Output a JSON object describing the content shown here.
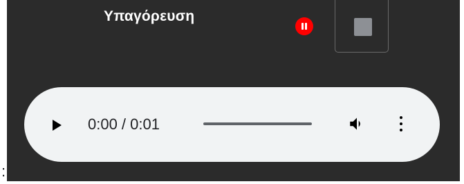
{
  "dictation": {
    "title": "Υπαγόρευση",
    "pause_icon": "pause-circle-icon",
    "stop_icon": "stop-square-icon",
    "colors": {
      "panel_bg": "#2b2b2b",
      "recording_red": "#ff0000",
      "stop_square": "#8d9095"
    }
  },
  "audio_player": {
    "time_display": "0:00 / 0:01",
    "progress_fraction": 0,
    "icons": {
      "play": "play-icon",
      "volume": "volume-icon",
      "more": "more-vertical-icon"
    },
    "colors": {
      "player_bg": "#f1f3f4"
    }
  },
  "edge_text": ":"
}
